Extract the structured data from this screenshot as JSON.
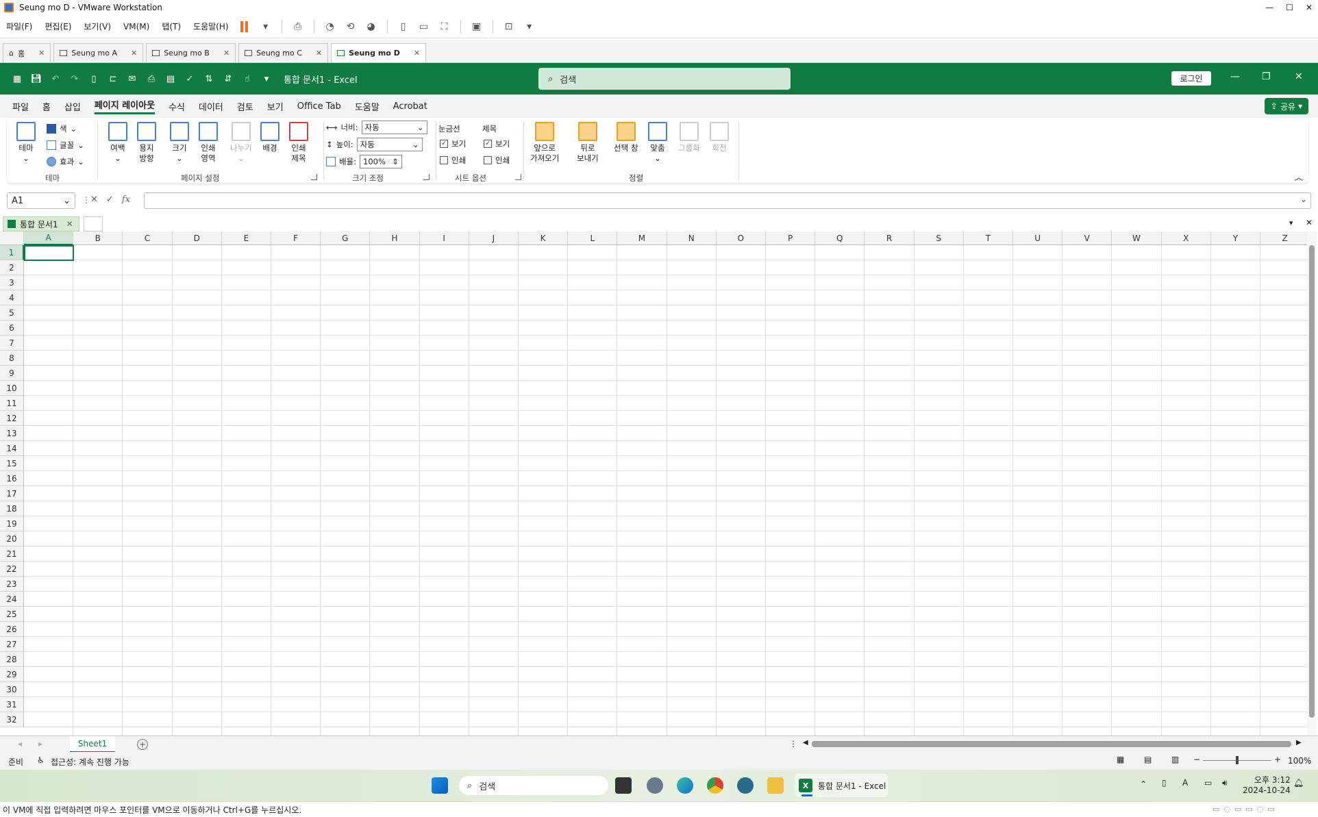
{
  "vm": {
    "title": "Seung mo D - VMware Workstation",
    "menu": [
      "파일(F)",
      "편집(E)",
      "보기(V)",
      "VM(M)",
      "탭(T)",
      "도움말(H)"
    ],
    "tabs": [
      {
        "label": "홈",
        "active": false
      },
      {
        "label": "Seung mo A",
        "active": false
      },
      {
        "label": "Seung mo B",
        "active": false
      },
      {
        "label": "Seung mo C",
        "active": false
      },
      {
        "label": "Seung mo D",
        "active": true
      }
    ],
    "status_text": "이 VM에 직접 입력하려면 마우스 포인터를 VM으로 이동하거나 Ctrl+G를 누르십시오."
  },
  "excel": {
    "doc_title": "통합 문서1  -  Excel",
    "search_placeholder": "검색",
    "login_label": "로그인",
    "share_label": "공유",
    "ribbon_tabs": [
      "파일",
      "홈",
      "삽입",
      "페이지 레이아웃",
      "수식",
      "데이터",
      "검토",
      "보기",
      "Office Tab",
      "도움말",
      "Acrobat"
    ],
    "active_ribbon_tab": "페이지 레이아웃",
    "ribbon": {
      "theme_group": "테마",
      "theme_btn": "테마",
      "colors": "색",
      "fonts": "글꼴",
      "effects": "효과",
      "page_setup_group": "페이지 설정",
      "margins": "여백",
      "orientation_1": "용지",
      "orientation_2": "방향",
      "size": "크기",
      "print_area_1": "인쇄",
      "print_area_2": "영역",
      "breaks": "나누기",
      "background": "배경",
      "print_titles_1": "인쇄",
      "print_titles_2": "제목",
      "scale_group": "크기 조정",
      "width_label": "너비:",
      "width_value": "자동",
      "height_label": "높이:",
      "height_value": "자동",
      "scale_label": "배율:",
      "scale_value": "100%",
      "sheet_options_group": "시트 옵션",
      "gridlines": "눈금선",
      "headings": "제목",
      "view": "보기",
      "print": "인쇄",
      "arrange_group": "정렬",
      "bring_forward_1": "앞으로",
      "bring_forward_2": "가져오기",
      "send_backward_1": "뒤로",
      "send_backward_2": "보내기",
      "selection_pane": "선택 창",
      "align": "맞춤",
      "group": "그룹화",
      "rotate": "회전"
    },
    "name_box": "A1",
    "fx": "fx",
    "workbook_tab": "통합 문서1",
    "columns": [
      "A",
      "B",
      "C",
      "D",
      "E",
      "F",
      "G",
      "H",
      "I",
      "J",
      "K",
      "L",
      "M",
      "N",
      "O",
      "P",
      "Q",
      "R",
      "S",
      "T",
      "U",
      "V",
      "W",
      "X",
      "Y",
      "Z"
    ],
    "rows": [
      "1",
      "2",
      "3",
      "4",
      "5",
      "6",
      "7",
      "8",
      "9",
      "10",
      "11",
      "12",
      "13",
      "14",
      "15",
      "16",
      "17",
      "18",
      "19",
      "20",
      "21",
      "22",
      "23",
      "24",
      "25",
      "26",
      "27",
      "28",
      "29",
      "30",
      "31",
      "32"
    ],
    "sheet_name": "Sheet1",
    "status_ready": "준비",
    "accessibility": "접근성: 계속 진행 가능",
    "zoom": "100%"
  },
  "taskbar": {
    "search_placeholder": "검색",
    "excel_label": "통합 문서1 - Excel",
    "time": "오후 3:12",
    "date": "2024-10-24"
  }
}
